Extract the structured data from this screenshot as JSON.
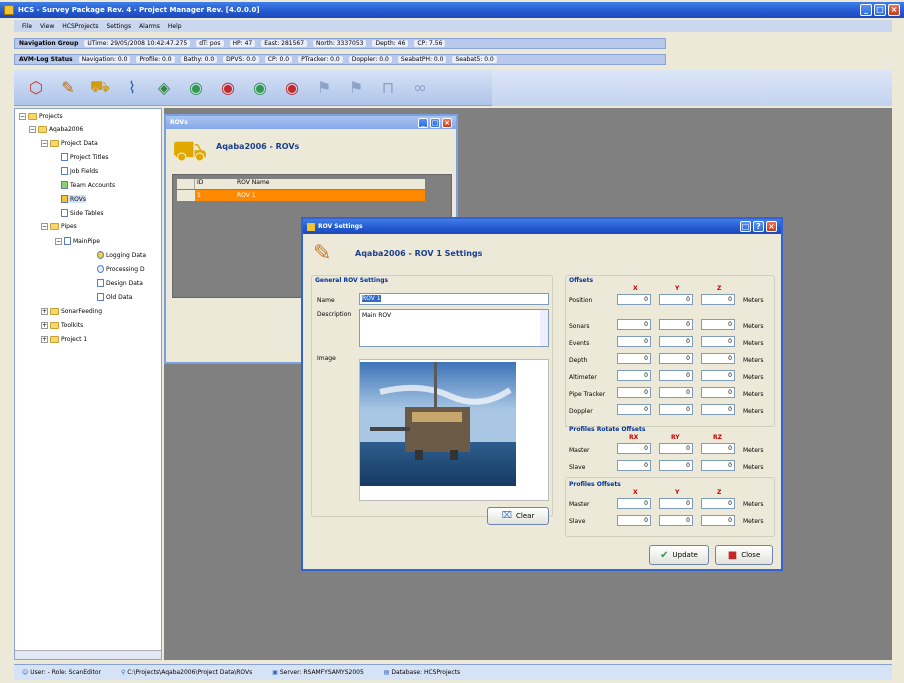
{
  "app": {
    "title": "HCS - Survey Package Rev. 4 - Project Manager Rev. [4.0.0.0]"
  },
  "menu": [
    "File",
    "View",
    "HCSProjects",
    "Settings",
    "Alarms",
    "Help"
  ],
  "nav_status": {
    "label": "Navigation Group",
    "items": [
      "UTime: 29/05/2008 10:42:47.275",
      "dT: pos",
      "HP: 47",
      "East: 281567",
      "North: 3337053",
      "Depth: 46",
      "CP: 7.56"
    ]
  },
  "avm_status": {
    "label": "AVM-Log Status",
    "items": [
      "Navigation: 0.0",
      "Profile: 0.0",
      "Bathy: 0.0",
      "DPVS: 0.0",
      "CP: 0.0",
      "PTracker: 0.0",
      "Doppler: 0.0",
      "SeabatPH: 0.0",
      "Seabat5: 0.0"
    ]
  },
  "toolbar": {
    "icons": [
      "projects-icon",
      "edit-icon",
      "vehicle-icon",
      "pipe-icon",
      "map-icon",
      "green-disk-icon",
      "red-disk-icon",
      "green-disk2-icon",
      "red-disk2-icon",
      "flag-icon",
      "flag2-icon",
      "lock-icon",
      "link-icon"
    ]
  },
  "tree": {
    "projects": "Projects",
    "aqaba": "Aqaba2006",
    "project_data": "Project Data",
    "project_titles": "Project Titles",
    "job_fields": "Job Fields",
    "team_accounts": "Team Accounts",
    "rovs": "ROVs",
    "side_tables": "Side Tables",
    "pipes": "Pipes",
    "mainpipe": "MainPipe",
    "logging_data": "Logging Data",
    "processing_data": "Processing D",
    "design_data": "Design Data",
    "old_data": "Old Data",
    "sonarfeeding": "SonarFeeding",
    "toolkits": "Toolkits",
    "project1": "Project 1"
  },
  "rov_list": {
    "window_title": "ROVs",
    "heading": "Aqaba2006 - ROVs",
    "columns": [
      "ID",
      "ROV Name"
    ],
    "rows": [
      {
        "id": "1",
        "name": "ROV 1"
      }
    ]
  },
  "rov_settings": {
    "window_title": "ROV Settings",
    "heading": "Aqaba2006 - ROV 1 Settings",
    "general_label": "General ROV Settings",
    "name_label": "Name",
    "name_value": "ROV 1",
    "description_label": "Description",
    "description_value": "Main ROV",
    "image_label": "Image",
    "clear_button": "Clear",
    "offsets_label": "Offsets",
    "axes": [
      "X",
      "Y",
      "Z"
    ],
    "units": "Meters",
    "offset_rows": [
      "Position",
      "Sonars",
      "Events",
      "Depth",
      "Altimeter",
      "Pipe Tracker",
      "Doppler"
    ],
    "profiles_rotate_label": "Profiles Rotate Offsets",
    "rotate_axes": [
      "RX",
      "RY",
      "RZ"
    ],
    "profiles_offsets_label": "Profiles Offsets",
    "master_label": "Master",
    "slave_label": "Slave",
    "value": "0",
    "update_button": "Update",
    "close_button": "Close"
  },
  "statusbar": {
    "user": "User: - Role: ScanEditor",
    "path": "C:\\Projects\\Aqaba2006\\Project Data\\ROVs",
    "server": "Server: RSAMFYSAMYS2005",
    "database": "Database: HCSProjects"
  }
}
